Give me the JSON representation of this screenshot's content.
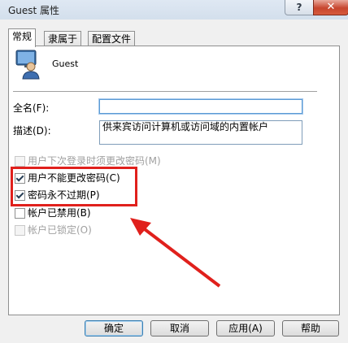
{
  "window": {
    "title": "Guest 属性",
    "help_label": "?",
    "close_label": "✕"
  },
  "tabs": [
    {
      "label": "常规",
      "active": true
    },
    {
      "label": "隶属于",
      "active": false
    },
    {
      "label": "配置文件",
      "active": false
    }
  ],
  "user": {
    "name": "Guest"
  },
  "fields": {
    "fullname_label": "全名(F):",
    "fullname_value": "",
    "description_label": "描述(D):",
    "description_value": "供来宾访问计算机或访问域的内置帐户"
  },
  "checkboxes": [
    {
      "label": "用户下次登录时须更改密码(M)",
      "checked": false,
      "enabled": false
    },
    {
      "label": "用户不能更改密码(C)",
      "checked": true,
      "enabled": true
    },
    {
      "label": "密码永不过期(P)",
      "checked": true,
      "enabled": true
    },
    {
      "label": "帐户已禁用(B)",
      "checked": false,
      "enabled": true
    },
    {
      "label": "帐户已锁定(O)",
      "checked": false,
      "enabled": false
    }
  ],
  "buttons": {
    "ok": "确定",
    "cancel": "取消",
    "apply": "应用(A)",
    "help": "帮助"
  },
  "colors": {
    "highlight": "#e0201c",
    "arrow": "#e0201c"
  }
}
